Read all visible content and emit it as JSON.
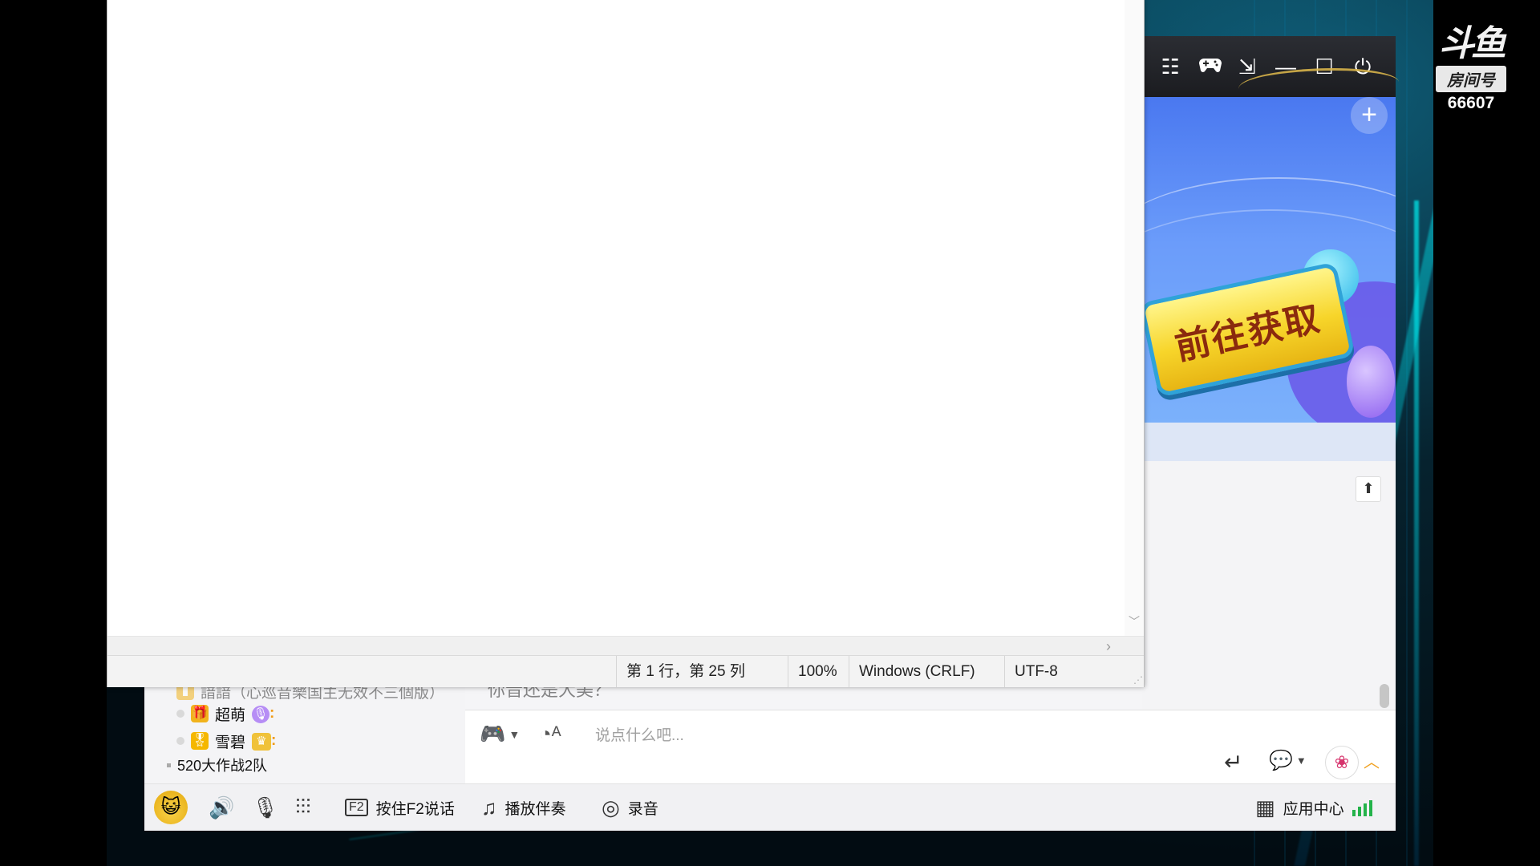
{
  "stream": {
    "brand_logo_text": "斗鱼",
    "room_label": "房间号",
    "room_number": "66607"
  },
  "notepad": {
    "content": "",
    "status": {
      "position": "第 1 行，第 25 列",
      "zoom": "100%",
      "line_ending": "Windows (CRLF)",
      "encoding": "UTF-8"
    }
  },
  "chat_app": {
    "titlebar_icons": [
      "list-icon",
      "gamepad-icon",
      "download-icon",
      "minimize-icon",
      "maximize-icon",
      "power-icon"
    ],
    "banner": {
      "cta_label": "前往获取"
    },
    "channel_tree": {
      "cut_row_text": "諳諳（心巡音樂国主无效不三個版）",
      "members": [
        {
          "name": "超萌",
          "rank_icon": "gift-rank-icon",
          "badge": "purple-mic-badge"
        },
        {
          "name": "雪碧",
          "rank_icon": "medal-rank-icon",
          "badge": "gold-crown-badge"
        }
      ],
      "team": "520大作战2队"
    },
    "chat": {
      "cut_message": "你音还是大美？",
      "input_placeholder": "说点什么吧..."
    },
    "toolbar": {
      "f2_label": "按住F2说话",
      "accompaniment_label": "播放伴奏",
      "record_label": "录音",
      "app_center_label": "应用中心"
    }
  },
  "colors": {
    "titlebar": "#1b1c20",
    "banner_blue": "#4a78f0",
    "cta_yellow": "#f7d52a",
    "signal_green": "#24b34a"
  }
}
